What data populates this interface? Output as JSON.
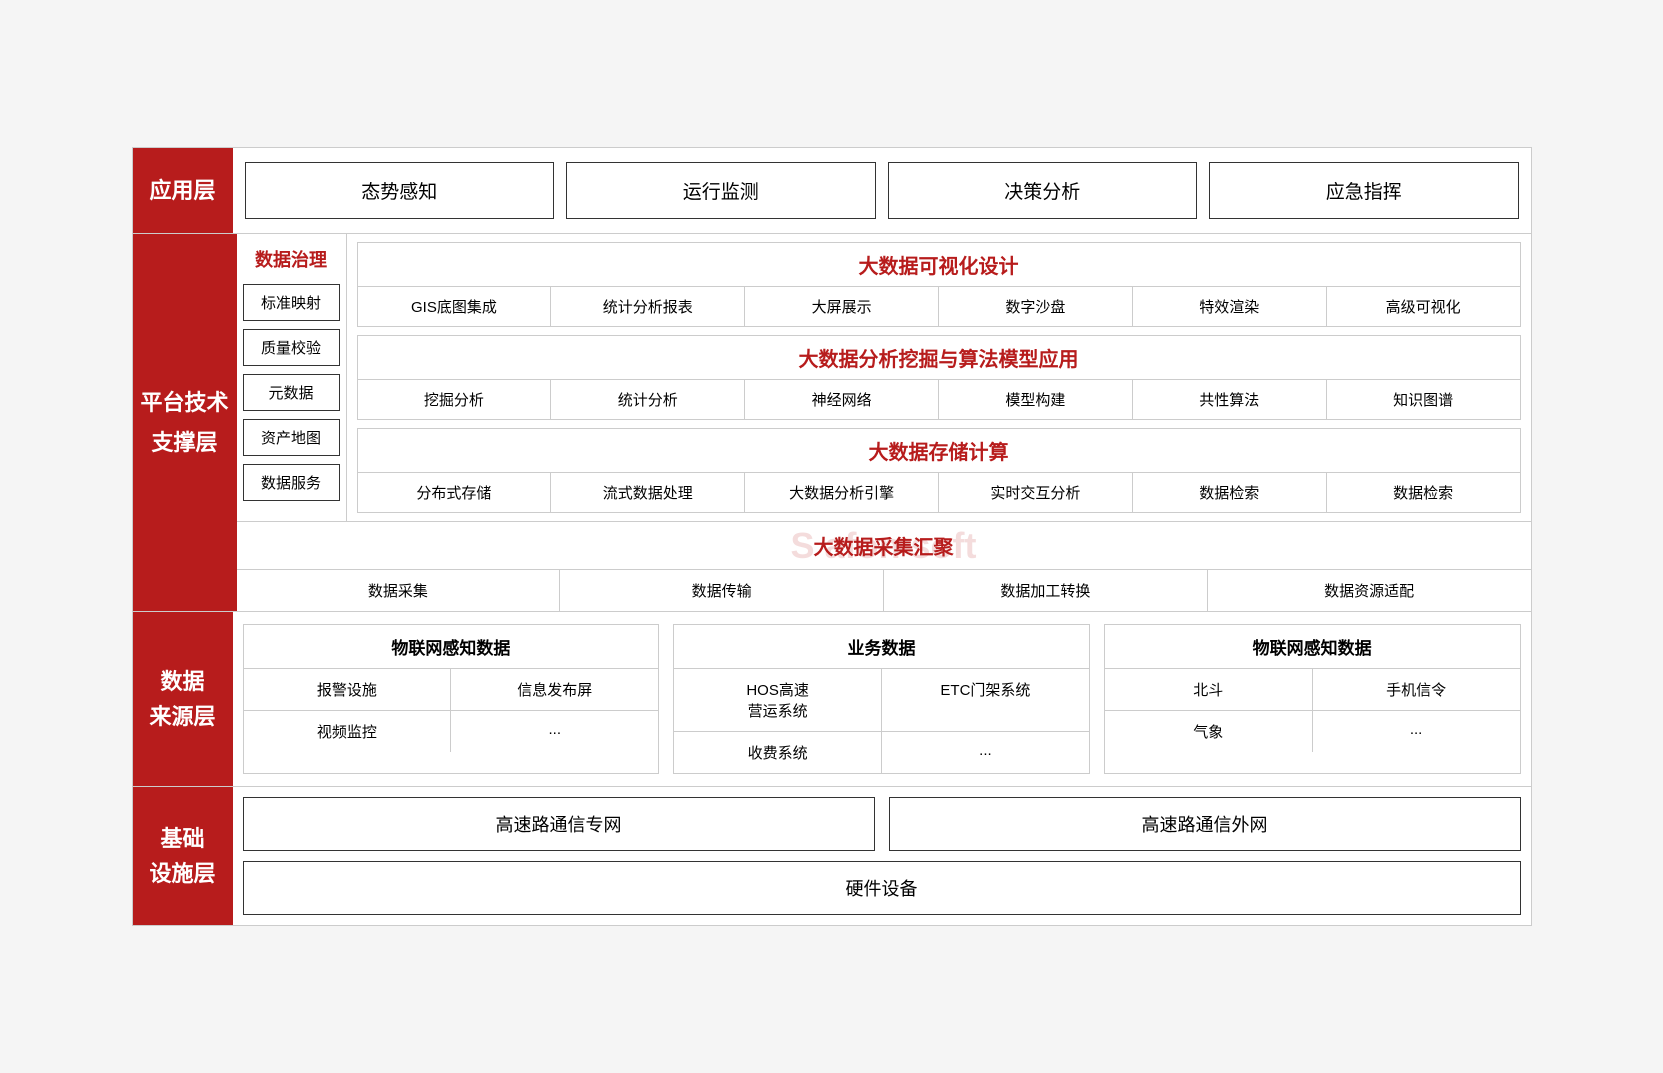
{
  "layers": {
    "app": {
      "label": "应用层",
      "items": [
        "态势感知",
        "运行监测",
        "决策分析",
        "应急指挥"
      ]
    },
    "platform": {
      "label": "平台技术\n支撑层",
      "governance": {
        "title": "数据治理",
        "items": [
          "标准映射",
          "质量校验",
          "元数据",
          "资产地图",
          "数据服务"
        ]
      },
      "visualization": {
        "title": "大数据可视化设计",
        "items": [
          "GIS底图集成",
          "统计分析报表",
          "大屏展示",
          "数字沙盘",
          "特效渲染",
          "高级可视化"
        ]
      },
      "analytics": {
        "title": "大数据分析挖掘与算法模型应用",
        "items": [
          "挖掘分析",
          "统计分析",
          "神经网络",
          "模型构建",
          "共性算法",
          "知识图谱"
        ]
      },
      "storage": {
        "title": "大数据存储计算",
        "items": [
          "分布式存储",
          "流式数据处理",
          "大数据分析引擎",
          "实时交互分析",
          "数据检索",
          "数据检索"
        ]
      },
      "collection": {
        "title": "大数据采集汇聚",
        "items": [
          "数据采集",
          "数据传输",
          "数据加工转换",
          "数据资源适配"
        ]
      }
    },
    "datasource": {
      "label": "数据\n来源层",
      "groups": [
        {
          "title": "物联网感知数据",
          "rows": [
            [
              "报警设施",
              "信息发布屏"
            ],
            [
              "视频监控",
              "..."
            ]
          ]
        },
        {
          "title": "业务数据",
          "rows": [
            [
              "HOS高速\n营运系统",
              "ETC门架系统"
            ],
            [
              "收费系统",
              "..."
            ]
          ]
        },
        {
          "title": "物联网感知数据",
          "rows": [
            [
              "北斗",
              "手机信令"
            ],
            [
              "气象",
              "..."
            ]
          ]
        }
      ]
    },
    "infra": {
      "label": "基础\n设施层",
      "networks": [
        "高速路通信专网",
        "高速路通信外网"
      ],
      "hardware": "硬件设备"
    }
  }
}
